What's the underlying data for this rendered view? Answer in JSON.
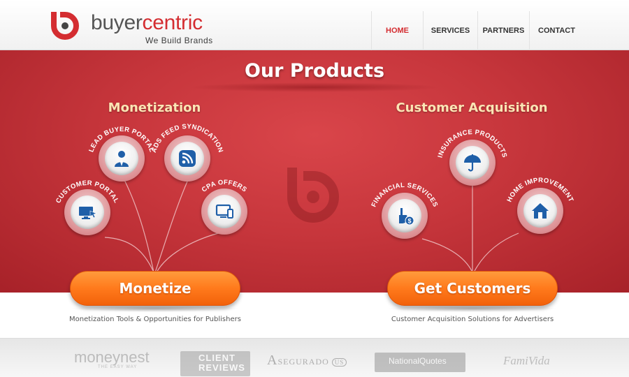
{
  "brand": {
    "name_part1": "buyer",
    "name_part2": "centric",
    "tagline": "We Build Brands",
    "colors": {
      "primary": "#d42d31",
      "text": "#555555",
      "cta": "#ff7a1c",
      "section_title": "#fbe5b4"
    },
    "icon": "bc-logo-icon"
  },
  "nav": {
    "items": [
      {
        "label": "HOME",
        "active": true
      },
      {
        "label": "SERVICES",
        "active": false
      },
      {
        "label": "PARTNERS",
        "active": false
      },
      {
        "label": "CONTACT",
        "active": false
      }
    ]
  },
  "hero": {
    "title": "Our Products",
    "monetization": {
      "title": "Monetization",
      "items": [
        {
          "label": "CUSTOMER PORTAL",
          "icon": "monitor-cursor-icon"
        },
        {
          "label": "LEAD BUYER PORTAL",
          "icon": "person-icon"
        },
        {
          "label": "ADS FEED SYNDICATION",
          "icon": "rss-icon"
        },
        {
          "label": "CPA OFFERS",
          "icon": "devices-icon"
        }
      ],
      "cta_label": "Monetize",
      "description": "Monetization Tools & Opportunities for Publishers"
    },
    "acquisition": {
      "title": "Customer Acquisition",
      "items": [
        {
          "label": "FINANCIAL SERVICES",
          "icon": "hand-coin-icon"
        },
        {
          "label": "INSURANCE PRODUCTS",
          "icon": "umbrella-icon"
        },
        {
          "label": "HOME IMPROVEMENT",
          "icon": "house-icon"
        }
      ],
      "cta_label": "Get Customers",
      "description": "Customer Acquisition Solutions for Advertisers"
    }
  },
  "partners": {
    "moneynest": {
      "name": "moneynest",
      "tagline": "THE EASY WAY"
    },
    "client_reviews": {
      "line1": "CLIENT",
      "line2": "REVIEWS"
    },
    "asegurado": {
      "initial": "A",
      "rest": "SEGURADO",
      "badge": "US"
    },
    "national_quotes": {
      "name": "NationalQuotes"
    },
    "famivida": {
      "name": "FamiVida"
    }
  }
}
